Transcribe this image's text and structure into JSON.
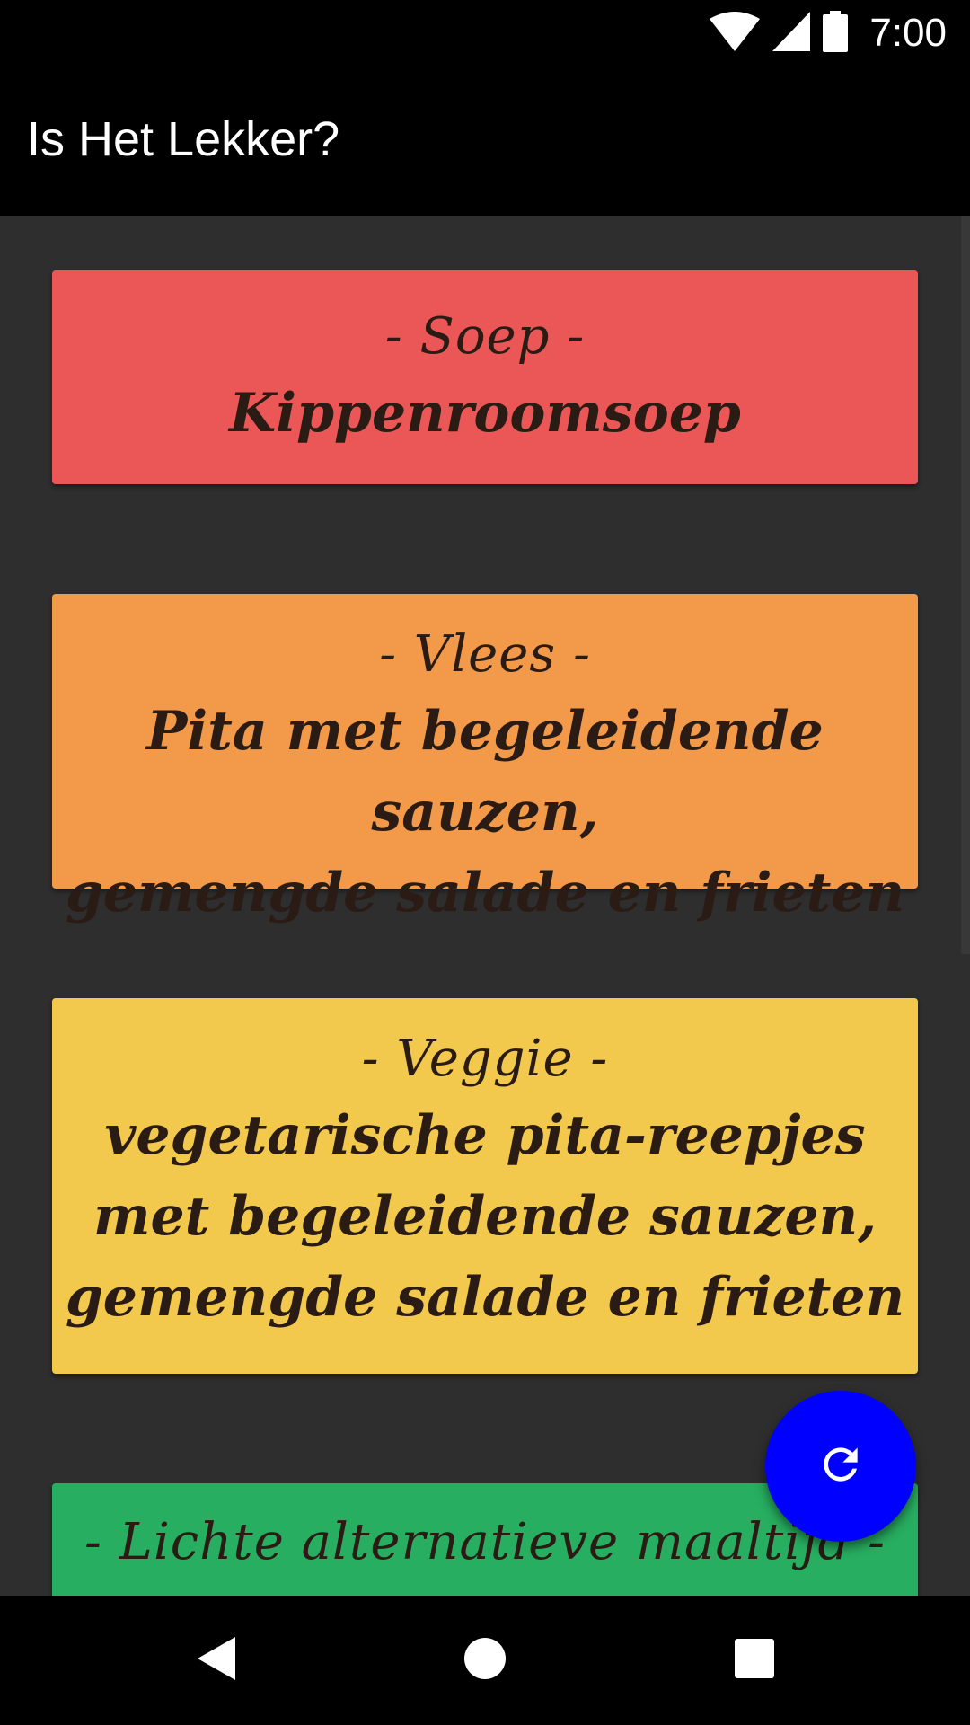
{
  "status_bar": {
    "time": "7:00",
    "icons": [
      "wifi-icon",
      "cell-signal-icon",
      "battery-icon"
    ]
  },
  "app_bar": {
    "title": "Is Het Lekker?"
  },
  "cards": [
    {
      "category": "- Soep -",
      "dish": "Kippenroomsoep",
      "color": "#eb5757"
    },
    {
      "category": "- Vlees -",
      "dish": "Pita met begeleidende sauzen,\ngemengde salade en frieten",
      "color": "#f2994a"
    },
    {
      "category": "- Veggie -",
      "dish": "vegetarische pita-reepjes\nmet begeleidende sauzen,\ngemengde salade en frieten",
      "color": "#f2c94c"
    },
    {
      "category": "- Lichte alternatieve maaltijd -",
      "dish": "",
      "color": "#27ae60"
    }
  ],
  "fab": {
    "icon": "refresh-icon",
    "color": "#0000ff"
  },
  "nav_bar": {
    "buttons": [
      "back-icon",
      "home-icon",
      "recents-icon"
    ]
  }
}
